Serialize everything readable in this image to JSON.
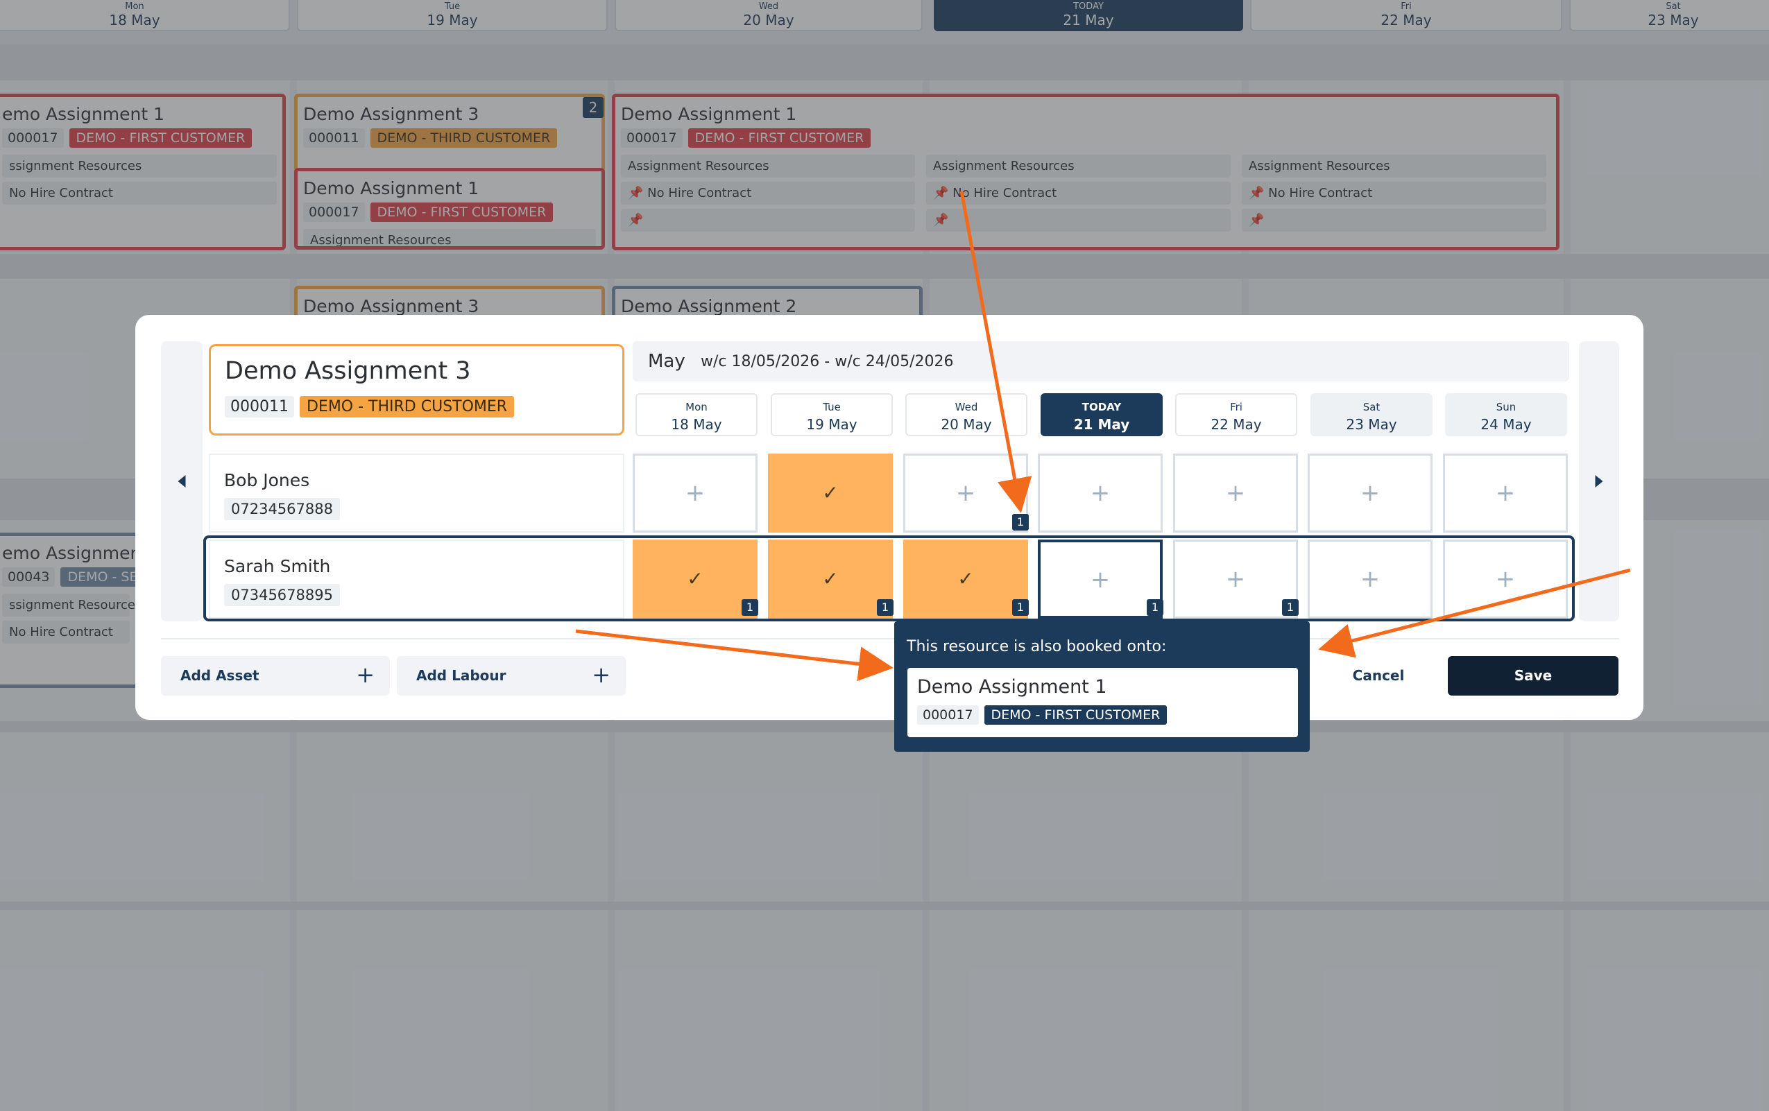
{
  "background": {
    "days": [
      {
        "day": "Mon",
        "date": "18 May"
      },
      {
        "day": "Tue",
        "date": "19 May"
      },
      {
        "day": "Wed",
        "date": "20 May"
      },
      {
        "day": "TODAY",
        "date": "21 May"
      },
      {
        "day": "Fri",
        "date": "22 May"
      },
      {
        "day": "Sat",
        "date": "23 May"
      }
    ],
    "cards": {
      "c1": {
        "title": "emo Assignment 1",
        "num": "000017",
        "tag": "DEMO - FIRST CUSTOMER",
        "res1": "ssignment Resources",
        "res2": "No Hire Contract"
      },
      "c2": {
        "title": "Demo Assignment 3",
        "num": "000011",
        "tag": "DEMO - THIRD CUSTOMER",
        "count": "2"
      },
      "c3": {
        "title": "Demo Assignment 1",
        "num": "000017",
        "tag": "DEMO - FIRST CUSTOMER",
        "res1": "Assignment Resources"
      },
      "c4": {
        "title": "Demo Assignment 1",
        "num": "000017",
        "tag": "DEMO - FIRST CUSTOMER",
        "res": "Assignment Resources",
        "nhc": "No Hire Contract",
        "pin": "📌"
      },
      "c5": {
        "title": "Demo Assignment 3"
      },
      "c6": {
        "title": "Demo Assignment 2"
      },
      "c7": {
        "title": "emo Assignmen",
        "num": "00043",
        "tag": "DEMO - SEC",
        "res1": "ssignment Resource",
        "res2": "No Hire Contract"
      }
    }
  },
  "modal": {
    "assignment": {
      "title": "Demo Assignment 3",
      "num": "000011",
      "tag": "DEMO - THIRD CUSTOMER"
    },
    "month": "May",
    "week_range": "w/c 18/05/2026 - w/c 24/05/2026",
    "days": [
      {
        "day": "Mon",
        "date": "18 May"
      },
      {
        "day": "Tue",
        "date": "19 May"
      },
      {
        "day": "Wed",
        "date": "20 May"
      },
      {
        "day": "TODAY",
        "date": "21 May"
      },
      {
        "day": "Fri",
        "date": "22 May"
      },
      {
        "day": "Sat",
        "date": "23 May"
      },
      {
        "day": "Sun",
        "date": "24 May"
      }
    ],
    "people": [
      {
        "name": "Bob Jones",
        "phone": "07234567888"
      },
      {
        "name": "Sarah Smith",
        "phone": "07345678895"
      }
    ],
    "plus": "+",
    "check": "✓",
    "badge": "1",
    "add_asset": "Add Asset",
    "add_labour": "Add Labour",
    "cancel": "Cancel",
    "save": "Save"
  },
  "popup": {
    "heading": "This resource is also booked onto:",
    "title": "Demo Assignment 1",
    "num": "000017",
    "tag": "DEMO - FIRST CUSTOMER"
  },
  "colors": {
    "accent": "#1c3a5a",
    "booked": "#ffb35e",
    "arrow": "#f26a1b",
    "red": "#e03e46",
    "orange": "#f5a443"
  }
}
